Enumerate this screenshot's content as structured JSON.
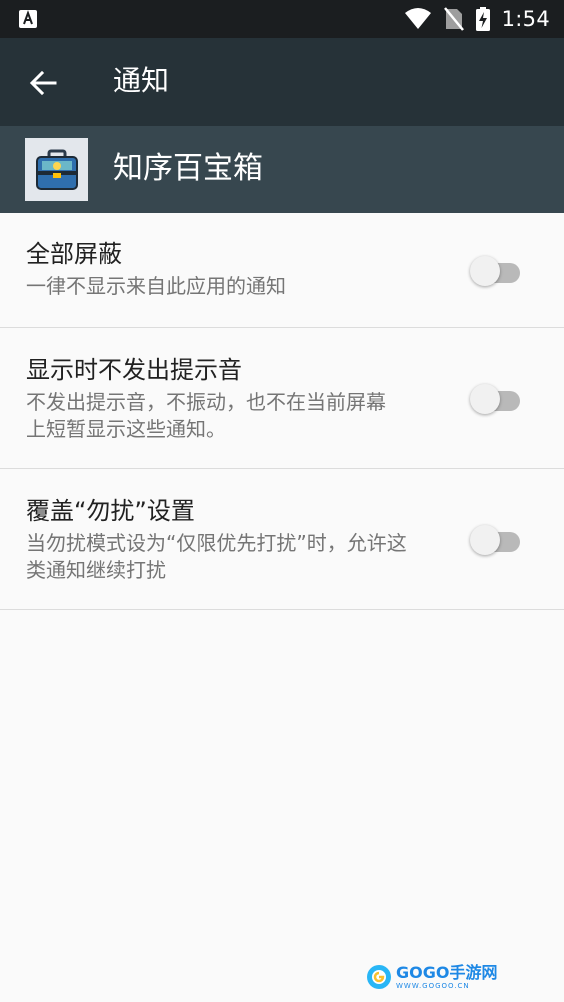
{
  "status_bar": {
    "time": "1:54",
    "icons": [
      "app-notification-icon",
      "wifi-icon",
      "no-sim-icon",
      "battery-charging-icon"
    ]
  },
  "toolbar": {
    "title": "通知",
    "back_icon": "arrow-back-icon"
  },
  "app": {
    "name": "知序百宝箱",
    "icon": "toolbox-icon"
  },
  "settings": [
    {
      "title": "全部屏蔽",
      "summary": "一律不显示来自此应用的通知",
      "enabled": false
    },
    {
      "title": "显示时不发出提示音",
      "summary_lines": [
        "不发出提示音，不振动，也不在当前屏幕",
        "上短暂显示这些通知。"
      ],
      "enabled": false
    },
    {
      "title": "覆盖“勿扰”设置",
      "summary_lines": [
        "当勿扰模式设为“仅限优先打扰”时，允许这",
        "类通知继续打扰"
      ],
      "enabled": false
    }
  ],
  "watermark": {
    "text": "GOGO手游网",
    "sub": "WWW.GOGOO.CN"
  },
  "colors": {
    "status_bar": "#1b1e20",
    "toolbar": "#263238",
    "app_header": "#37474f",
    "background": "#fafafa",
    "switch_track_off": "#b9b9b9",
    "switch_thumb_off": "#f1f1f1"
  }
}
